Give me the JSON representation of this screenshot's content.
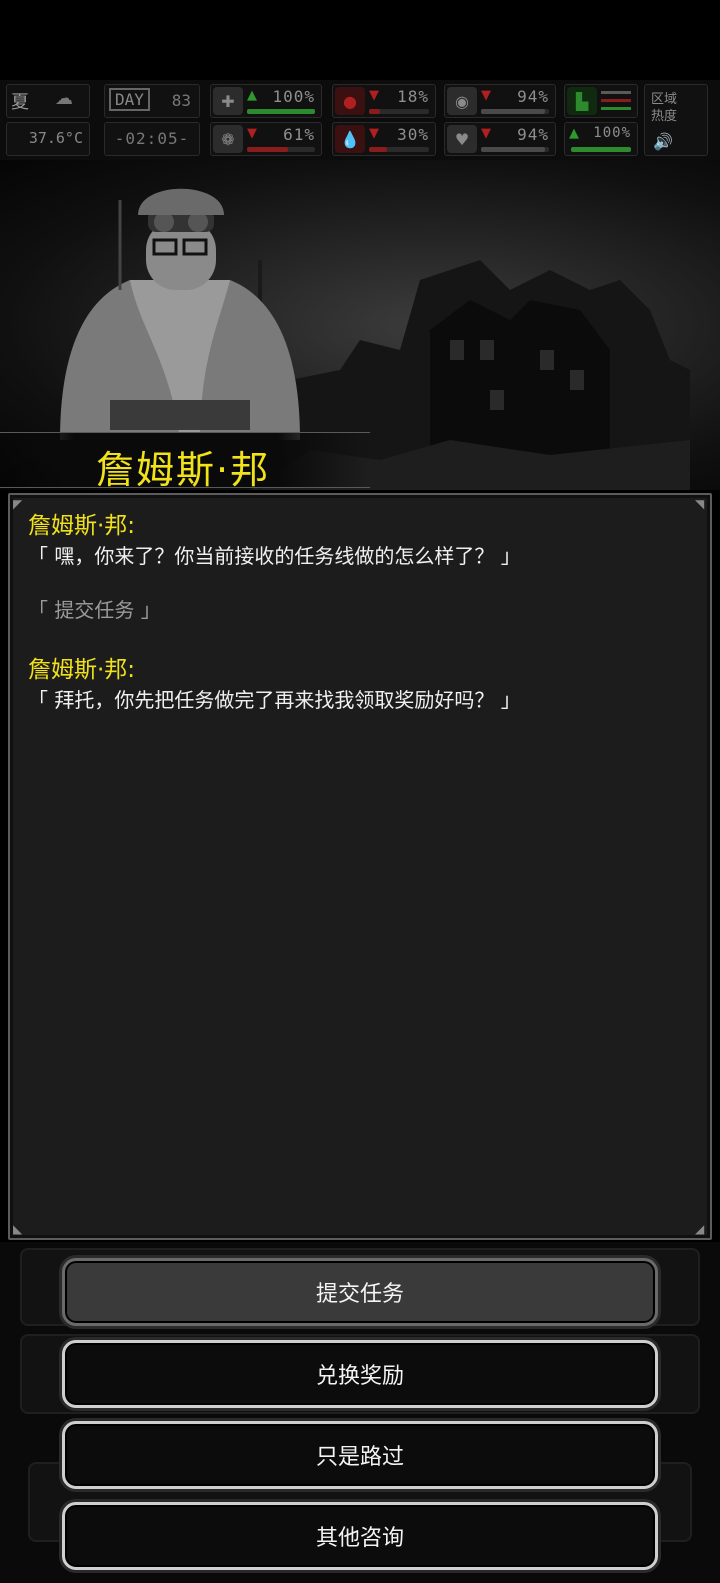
{
  "status": {
    "season": "夏",
    "temperature": "37.6°C",
    "day_label": "DAY",
    "day": "83",
    "clock": "-02:05-",
    "area_label": "区域热度",
    "stats": [
      {
        "icon": "medkit-icon",
        "value": "100%",
        "trend": "up",
        "fill": 1.0
      },
      {
        "icon": "stomach-icon",
        "value": "18%",
        "trend": "down",
        "fill": 0.18
      },
      {
        "icon": "stamina-icon",
        "value": "94%",
        "trend": "down",
        "fill": 0.94
      },
      {
        "icon": "boot-icon",
        "value": "",
        "trend": "up",
        "fill": 1.0
      },
      {
        "icon": "brain-icon",
        "value": "61%",
        "trend": "down",
        "fill": 0.61
      },
      {
        "icon": "water-drop-icon",
        "value": "30%",
        "trend": "down",
        "fill": 0.3
      },
      {
        "icon": "heart-icon",
        "value": "94%",
        "trend": "down",
        "fill": 0.94
      },
      {
        "icon": "energy-icon",
        "value": "100%",
        "trend": "up",
        "fill": 1.0
      }
    ]
  },
  "npc": {
    "name": "詹姆斯·邦"
  },
  "dialog": {
    "messages": [
      {
        "speaker": "詹姆斯·邦:",
        "text": "「 嘿，你来了？你当前接收的任务线做的怎么样了？ 」"
      },
      {
        "reply": "「 提交任务 」"
      },
      {
        "speaker": "詹姆斯·邦:",
        "text": "「 拜托，你先把任务做完了再来找我领取奖励好吗？ 」"
      }
    ]
  },
  "actions": [
    {
      "label": "提交任务",
      "active": true
    },
    {
      "label": "兑换奖励",
      "active": false
    },
    {
      "label": "只是路过",
      "active": false
    },
    {
      "label": "其他咨询",
      "active": false
    }
  ],
  "colors": {
    "speaker": "#f2e21a",
    "text": "#f0f0f0",
    "reply": "#9a9a9a",
    "panel": "#1c1c1c"
  }
}
